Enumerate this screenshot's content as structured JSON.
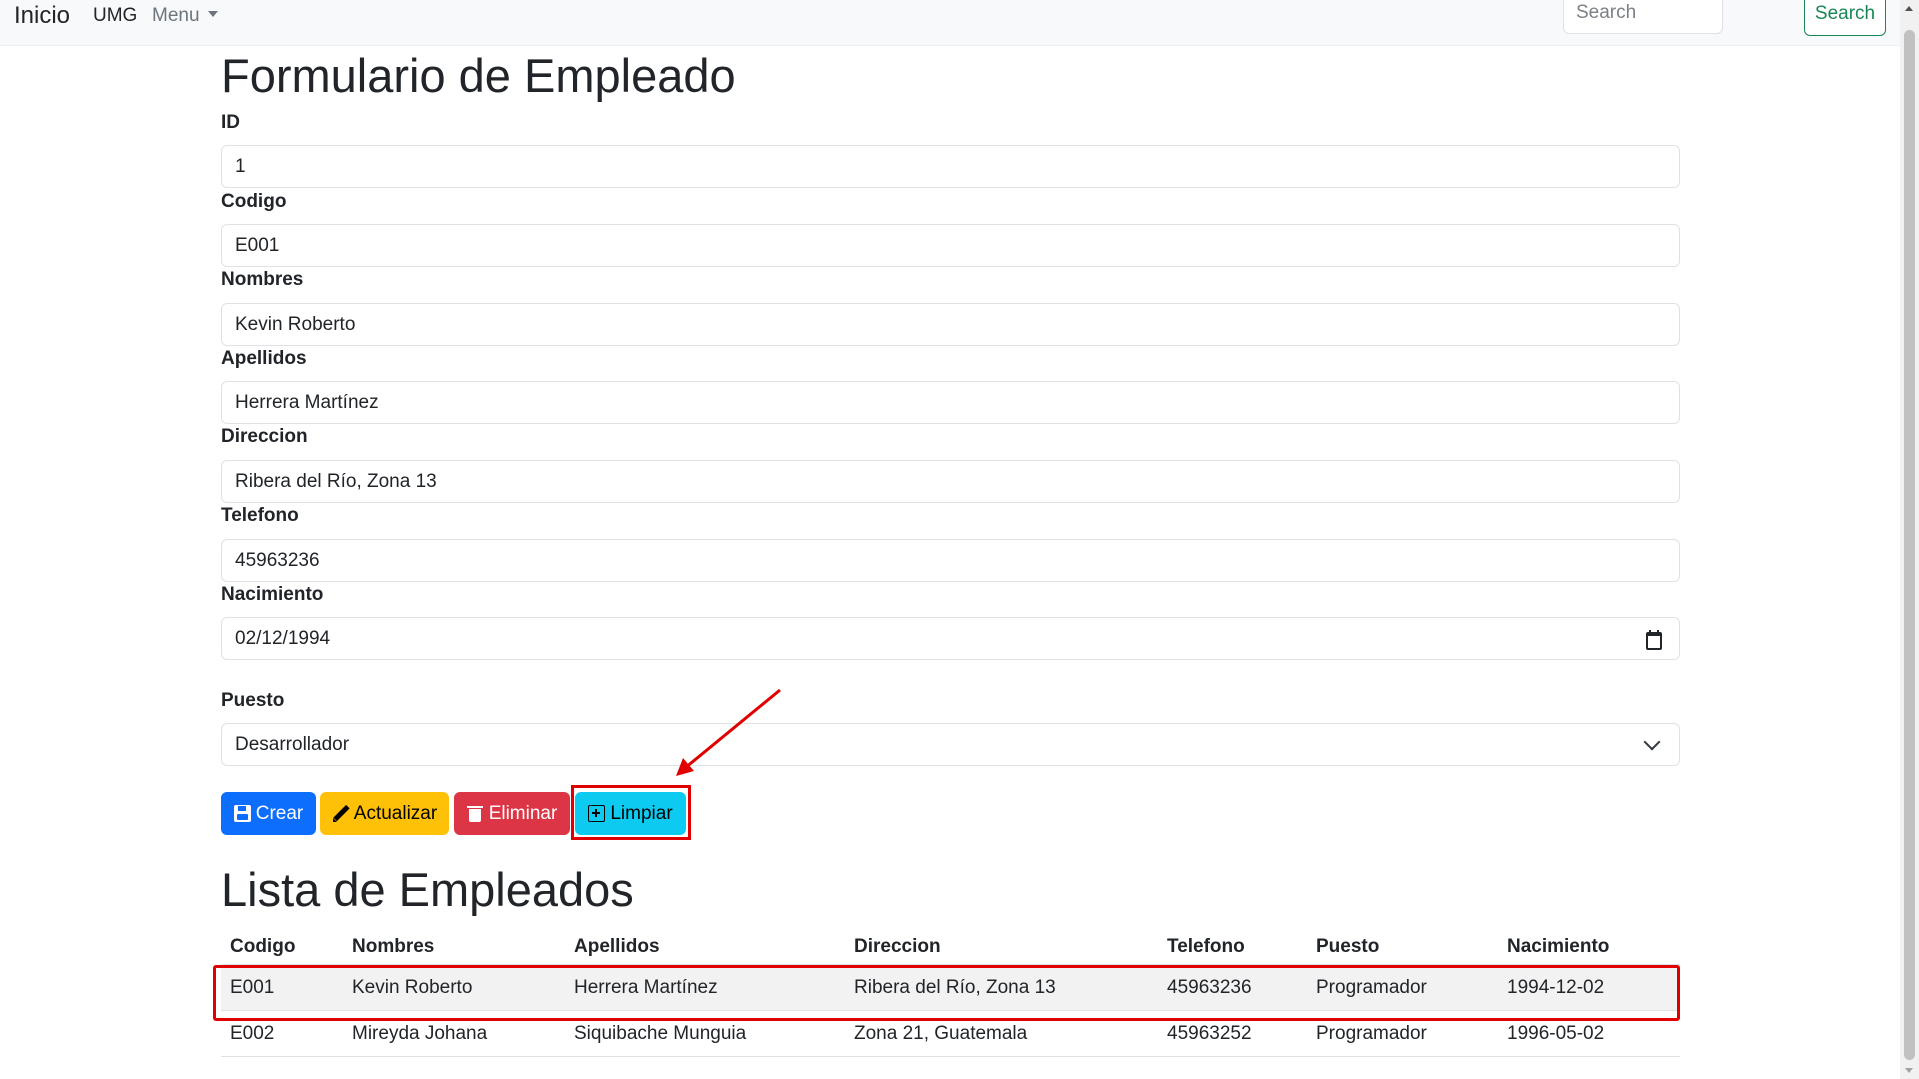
{
  "navbar": {
    "brand": "Inicio",
    "links": [
      "UMG",
      "Menu"
    ],
    "search_placeholder": "Search",
    "search_button": "Search"
  },
  "form": {
    "title": "Formulario de Empleado",
    "fields": [
      {
        "label": "ID",
        "value": "1"
      },
      {
        "label": "Codigo",
        "value": "E001"
      },
      {
        "label": "Nombres",
        "value": "Kevin Roberto"
      },
      {
        "label": "Apellidos",
        "value": "Herrera Martínez"
      },
      {
        "label": "Direccion",
        "value": "Ribera del Río, Zona 13"
      },
      {
        "label": "Telefono",
        "value": "45963236"
      },
      {
        "label": "Nacimiento",
        "value": "02/12/1994"
      }
    ],
    "puesto_label": "Puesto",
    "puesto_selected": "Desarrollador",
    "buttons": {
      "crear": "Crear",
      "actualizar": "Actualizar",
      "eliminar": "Eliminar",
      "limpiar": "Limpiar"
    }
  },
  "list": {
    "title": "Lista de Empleados",
    "columns": [
      "Codigo",
      "Nombres",
      "Apellidos",
      "Direccion",
      "Telefono",
      "Puesto",
      "Nacimiento"
    ],
    "rows": [
      [
        "E001",
        "Kevin Roberto",
        "Herrera Martínez",
        "Ribera del Río, Zona 13",
        "45963236",
        "Programador",
        "1994-12-02"
      ],
      [
        "E002",
        "Mireyda Johana",
        "Siquibache Munguia",
        "Zona 21, Guatemala",
        "45963252",
        "Programador",
        "1996-05-02"
      ]
    ]
  },
  "colors": {
    "highlight": "#e00000",
    "primary": "#0d6efd",
    "warning": "#ffc107",
    "danger": "#dc3545",
    "info": "#0dcaf0",
    "success": "#198754"
  },
  "icons": {
    "crear": "save-icon",
    "actualizar": "pencil-icon",
    "eliminar": "trash-icon",
    "limpiar": "plus-square-icon",
    "nacimiento": "calendar-icon",
    "puesto": "chevron-down-icon"
  }
}
